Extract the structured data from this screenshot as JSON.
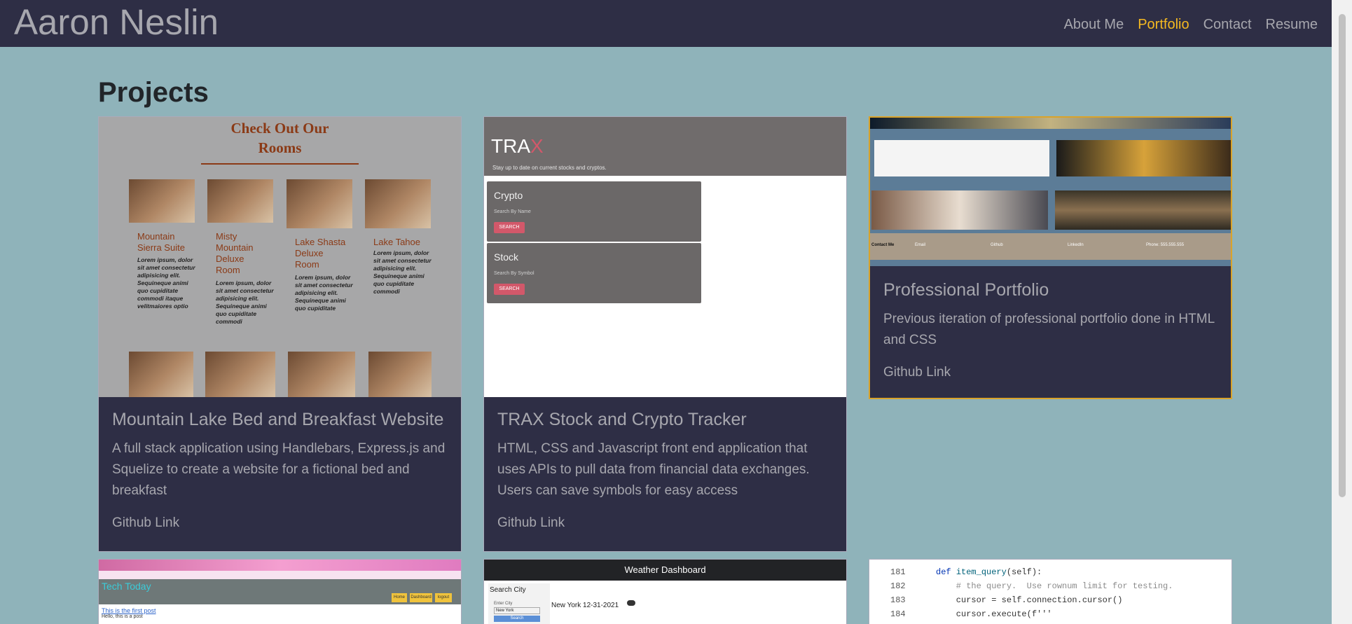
{
  "header": {
    "brand": "Aaron Neslin",
    "nav": [
      {
        "label": "About Me",
        "active": false
      },
      {
        "label": "Portfolio",
        "active": true
      },
      {
        "label": "Contact",
        "active": false
      },
      {
        "label": "Resume",
        "active": false
      }
    ]
  },
  "main": {
    "heading": "Projects",
    "projects": [
      {
        "title": "Mountain Lake Bed and Breakfast Website",
        "description": "A full stack application using Handlebars, Express.js and Squelize to create a website for a fictional bed and breakfast",
        "link": "Github Link",
        "screenshot": {
          "heading": "Check Out Our Rooms",
          "rooms": [
            {
              "name": "Mountain Sierra Suite",
              "text": "Lorem ipsum, dolor sit amet consectetur adipisicing elit. Sequineque animi quo cupiditate commodi itaque velitmaiores optio"
            },
            {
              "name": "Misty Mountain Deluxe Room",
              "text": "Lorem ipsum, dolor sit amet consectetur adipisicing elit. Sequineque animi quo cupiditate commodi"
            },
            {
              "name": "Lake Shasta Deluxe Room",
              "text": "Lorem ipsum, dolor sit amet consectetur adipisicing elit. Sequineque animi quo cupiditate"
            },
            {
              "name": "Lake Tahoe",
              "text": "Lorem ipsum, dolor sit amet consectetur adipisicing elit. Sequineque animi quo cupiditate commodi"
            }
          ]
        }
      },
      {
        "title": "TRAX Stock and Crypto Tracker",
        "description": "HTML, CSS and Javascript front end application that uses APIs to pull data from financial data exchanges. Users can save symbols for easy access",
        "link": "Github Link",
        "screenshot": {
          "logo_main": "TRA",
          "logo_accent": "X",
          "tagline": "Stay up to date on current stocks and cryptos.",
          "panels": [
            {
              "label": "Crypto",
              "placeholder": "Search By Name",
              "button": "SEARCH"
            },
            {
              "label": "Stock",
              "placeholder": "Search By Symbol",
              "button": "SEARCH"
            }
          ]
        }
      },
      {
        "title": "Professional Portfolio",
        "description": "Previous iteration of professional portfolio done in HTML and CSS",
        "link": "Github Link",
        "screenshot": {
          "contact": "Contact Me",
          "contact_items": [
            "Email",
            "Github",
            "LinkedIn",
            "Phone: 555.555.555"
          ]
        }
      }
    ],
    "partial_projects": [
      {
        "blog_title": "Tech Today",
        "blog_buttons": [
          "Home",
          "Dashboard",
          "logout"
        ],
        "post_link": "This is the first post",
        "post_text": "Hello, this is a post"
      },
      {
        "title": "Weather Dashboard",
        "search_label": "Search City",
        "enter_label": "Enter City",
        "input_value": "New York",
        "button": "Search",
        "city_date": "New York 12-31-2021"
      },
      {
        "code_lines": [
          {
            "num": "181",
            "text": "def item_query(self):"
          },
          {
            "num": "182",
            "text": "    # the query.  Use rownum limit for testing."
          },
          {
            "num": "183",
            "text": "    cursor = self.connection.cursor()"
          },
          {
            "num": "184",
            "text": "    cursor.execute(f'''"
          }
        ]
      }
    ]
  },
  "colors": {
    "background": "#8fb3ba",
    "navbar": "#2e2e45",
    "card": "#2e2e45",
    "active": "#f5b921"
  }
}
